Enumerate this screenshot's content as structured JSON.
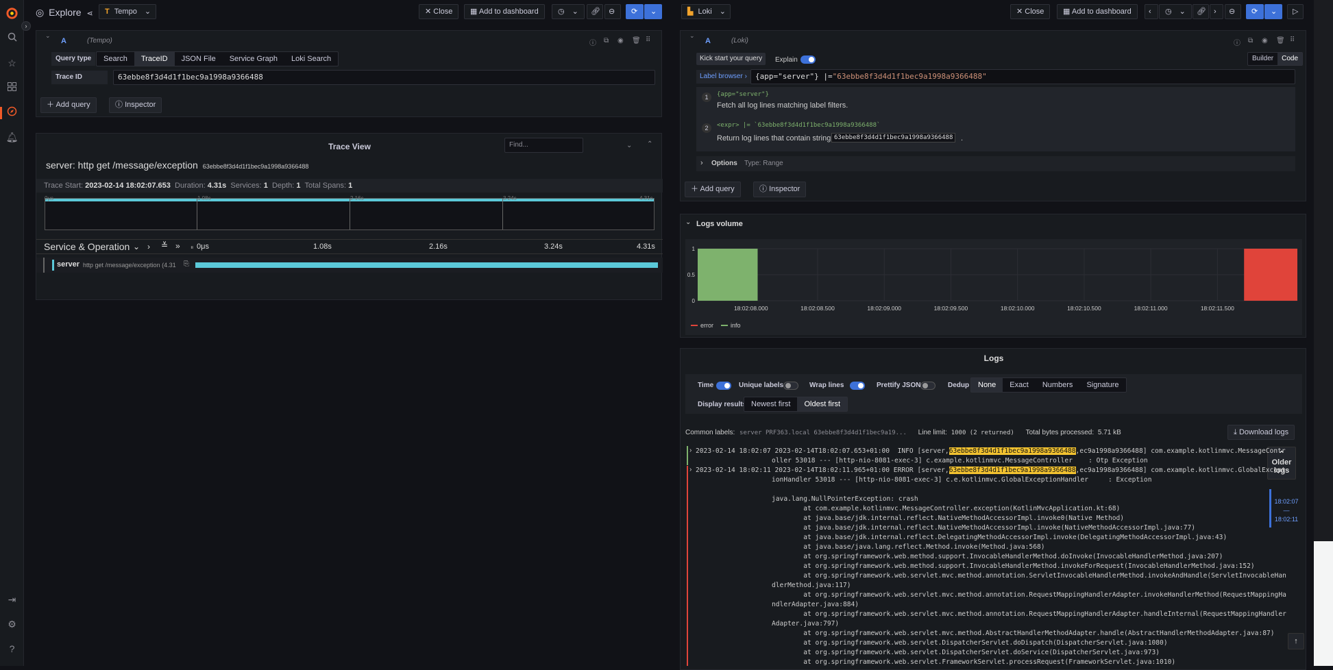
{
  "nav": {
    "icons": [
      "grafana-logo-icon",
      "search-icon",
      "star-icon",
      "dashboards-icon",
      "explore-icon",
      "alert-bell-icon",
      "sign-in-icon",
      "gear-icon",
      "help-icon"
    ]
  },
  "left": {
    "title": "Explore",
    "datasource": "Tempo",
    "close": "Close",
    "add_to_dashboard": "Add to dashboard",
    "query_letter": "A",
    "query_ds": "(Tempo)",
    "query_type_label": "Query type",
    "query_types": [
      "Search",
      "TraceID",
      "JSON File",
      "Service Graph",
      "Loki Search"
    ],
    "query_type_selected": "TraceID",
    "trace_id_label": "Trace ID",
    "trace_id_value": "63ebbe8f3d4d1f1bec9a1998a9366488",
    "add_query": "Add query",
    "inspector": "Inspector",
    "trace_view_title": "Trace View",
    "find_placeholder": "Find...",
    "trace_name": "server: http get /message/exception",
    "trace_id_small": "63ebbe8f3d4d1f1bec9a1998a9366488",
    "trace_start_label": "Trace Start:",
    "trace_start": "2023-02-14 18:02:07.653",
    "duration_label": "Duration:",
    "duration": "4.31s",
    "services_label": "Services:",
    "services": "1",
    "depth_label": "Depth:",
    "depth": "1",
    "total_spans_label": "Total Spans:",
    "total_spans": "1",
    "minimap_ticks": [
      "0μs",
      "1.08s",
      "2.16s",
      "3.24s",
      "4.31s"
    ],
    "service_op_header": "Service & Operation",
    "timeline_ticks": [
      "0μs",
      "1.08s",
      "2.16s",
      "3.24s",
      "4.31s"
    ],
    "span_service": "server",
    "span_op": "http get /message/exception (4.31"
  },
  "right": {
    "datasource": "Loki",
    "close": "Close",
    "add_to_dashboard": "Add to dashboard",
    "query_letter": "A",
    "query_ds": "(Loki)",
    "kick_start": "Kick start your query",
    "explain": "Explain",
    "builder": "Builder",
    "code": "Code",
    "label_browser": "Label browser",
    "query_sel": "{app=\"server\"}",
    "query_op": "|=",
    "query_str": "\"63ebbe8f3d4d1f1bec9a1998a9366488\"",
    "explain_1_code": "{app=\"server\"}",
    "explain_1_text": "Fetch all log lines matching label filters.",
    "explain_2_code": "<expr> |= `63ebbe8f3d4d1f1bec9a1998a9366488`",
    "explain_2_text": "Return log lines that contain string",
    "explain_2_tag": "63ebbe8f3d4d1f1bec9a1998a9366488",
    "options": "Options",
    "options_type": "Type: Range",
    "add_query": "Add query",
    "inspector": "Inspector",
    "logs_volume": "Logs volume",
    "logs_title": "Logs",
    "time": "Time",
    "unique_labels": "Unique labels",
    "wrap_lines": "Wrap lines",
    "prettify_json": "Prettify JSON",
    "dedup": "Dedup",
    "dedup_options": [
      "None",
      "Exact",
      "Numbers",
      "Signature"
    ],
    "display_results": "Display results",
    "order_options": [
      "Newest first",
      "Oldest first"
    ],
    "common_labels_label": "Common labels:",
    "common_labels": "server PRF363.local 63ebbe8f3d4d1f1bec9a19...",
    "line_limit_label": "Line limit:",
    "line_limit": "1000 (2 returned)",
    "bytes_label": "Total bytes processed:",
    "bytes": "5.71 kB",
    "download_logs": "Download logs",
    "older_logs": "Older logs",
    "range_start": "18:02:07",
    "range_dash": "—",
    "range_end": "18:02:11",
    "log1_time": "2023-02-14 18:02:07",
    "log1_a": "2023-02-14T18:02:07.653+01:00  INFO [server,",
    "log1_hl": "63ebbe8f3d4d1f1bec9a1998a9366488",
    "log1_b": ",ec9a1998a9366488] com.example.kotlinmvc.MessageContr",
    "log1_c": "oller 53018 --- [http-nio-8081-exec-3] c.example.kotlinmvc.MessageController    : Otp Exception",
    "log2_time": "2023-02-14 18:02:11",
    "log2_a": "2023-02-14T18:02:11.965+01:00 ERROR [server,",
    "log2_hl": "63ebbe8f3d4d1f1bec9a1998a9366488",
    "log2_b": ",ec9a1998a9366488] com.example.kotlinmvc.GlobalExcept",
    "log2_c": "ionHandler 53018 --- [http-nio-8081-exec-3] c.e.kotlinmvc.GlobalExceptionHandler     : Exception",
    "stack": [
      "java.lang.NullPointerException: crash",
      "        at com.example.kotlinmvc.MessageController.exception(KotlinMvcApplication.kt:68)",
      "        at java.base/jdk.internal.reflect.NativeMethodAccessorImpl.invoke0(Native Method)",
      "        at java.base/jdk.internal.reflect.NativeMethodAccessorImpl.invoke(NativeMethodAccessorImpl.java:77)",
      "        at java.base/jdk.internal.reflect.DelegatingMethodAccessorImpl.invoke(DelegatingMethodAccessorImpl.java:43)",
      "        at java.base/java.lang.reflect.Method.invoke(Method.java:568)",
      "        at org.springframework.web.method.support.InvocableHandlerMethod.doInvoke(InvocableHandlerMethod.java:207)",
      "        at org.springframework.web.method.support.InvocableHandlerMethod.invokeForRequest(InvocableHandlerMethod.java:152)",
      "        at org.springframework.web.servlet.mvc.method.annotation.ServletInvocableHandlerMethod.invokeAndHandle(ServletInvocableHan",
      "dlerMethod.java:117)",
      "        at org.springframework.web.servlet.mvc.method.annotation.RequestMappingHandlerAdapter.invokeHandlerMethod(RequestMappingHa",
      "ndlerAdapter.java:884)",
      "        at org.springframework.web.servlet.mvc.method.annotation.RequestMappingHandlerAdapter.handleInternal(RequestMappingHandler",
      "Adapter.java:797)",
      "        at org.springframework.web.servlet.mvc.method.AbstractHandlerMethodAdapter.handle(AbstractHandlerMethodAdapter.java:87)",
      "        at org.springframework.web.servlet.DispatcherServlet.doDispatch(DispatcherServlet.java:1080)",
      "        at org.springframework.web.servlet.DispatcherServlet.doService(DispatcherServlet.java:973)",
      "        at org.springframework.web.servlet.FrameworkServlet.processRequest(FrameworkServlet.java:1010)"
    ]
  },
  "chart_data": {
    "type": "bar",
    "x": [
      "18:02:08.000",
      "18:02:08.500",
      "18:02:09.000",
      "18:02:09.500",
      "18:02:10.000",
      "18:02:10.500",
      "18:02:11.000",
      "18:02:11.500"
    ],
    "yticks": [
      "0",
      "0.5",
      "1"
    ],
    "ylim": [
      0,
      1
    ],
    "series": [
      {
        "name": "error",
        "color": "#e0443a",
        "bars": [
          {
            "start": "18:02:11.7",
            "end": "18:02:12.1",
            "value": 1
          }
        ]
      },
      {
        "name": "info",
        "color": "#7eb26d",
        "bars": [
          {
            "start": "18:02:07.6",
            "end": "18:02:08.05",
            "value": 1
          }
        ]
      }
    ]
  }
}
